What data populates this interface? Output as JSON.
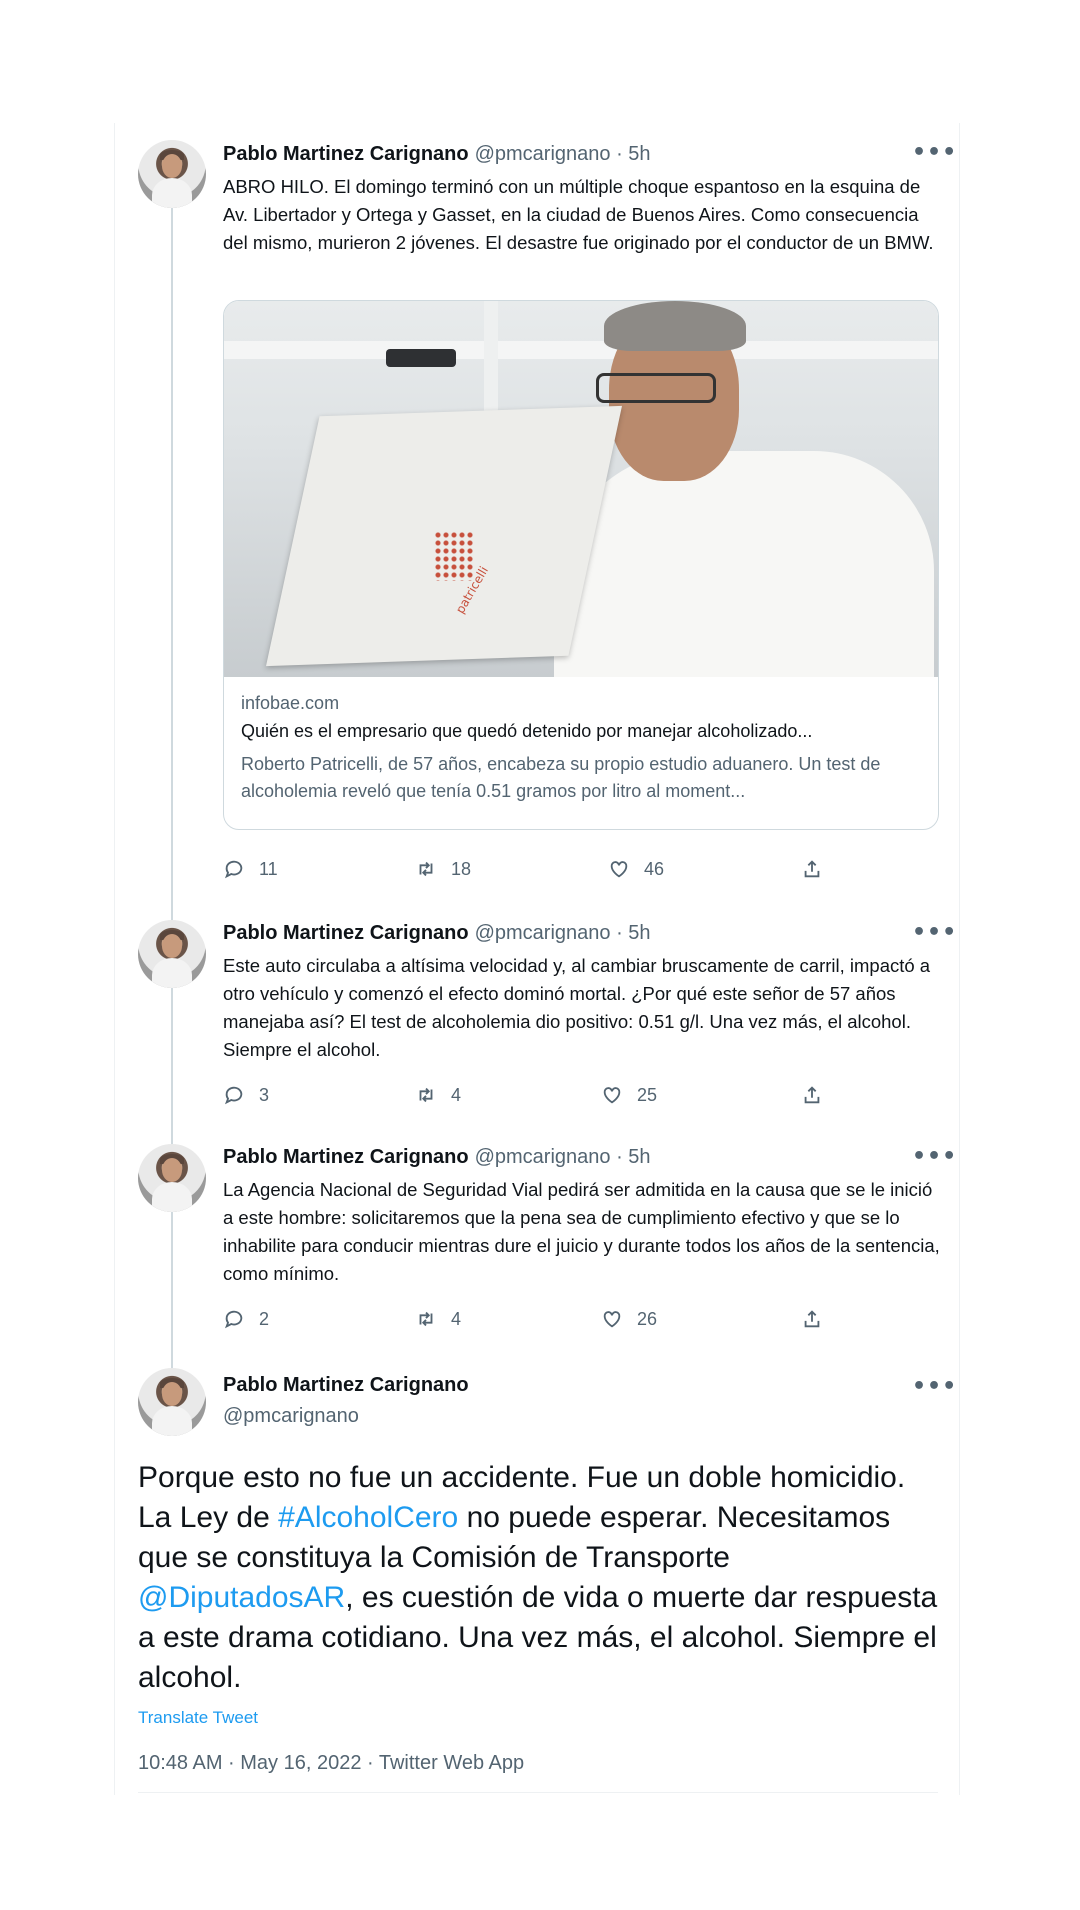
{
  "tweets": [
    {
      "author": "Pablo Martinez Carignano",
      "meta": "@pmcarignano · 5h",
      "text": "ABRO HILO. El domingo terminó con un múltiple choque espantoso en la esquina de Av. Libertador y Ortega y Gasset, en la ciudad de Buenos Aires. Como consecuencia del mismo, murieron 2 jóvenes. El desastre fue originado por el conductor de un BMW.",
      "card": {
        "domain": "infobae.com",
        "title": "Quién es el empresario que quedó detenido por manejar alcoholizado...",
        "description": "Roberto Patricelli, de 57 años, encabeza su propio estudio aduanero. Un test de alcoholemia reveló que tenía 0.51 gramos por litro al moment...",
        "image_text": "patricelli"
      },
      "replies": "11",
      "retweets": "18",
      "likes": "46"
    },
    {
      "author": "Pablo Martinez Carignano",
      "meta": "@pmcarignano · 5h",
      "text": "Este auto circulaba a altísima velocidad y, al cambiar bruscamente de carril, impactó a otro vehículo y comenzó el efecto dominó mortal. ¿Por qué este señor de 57 años manejaba así? El test de alcoholemia dio positivo: 0.51 g/l. Una vez más, el alcohol. Siempre el alcohol.",
      "replies": "3",
      "retweets": "4",
      "likes": "25"
    },
    {
      "author": "Pablo Martinez Carignano",
      "meta": "@pmcarignano · 5h",
      "text": "La Agencia Nacional de Seguridad Vial pedirá ser admitida en la causa que se le inició a este hombre: solicitaremos que la pena sea de cumplimiento efectivo y que se lo inhabilite para conducir mientras dure el juicio y durante todos los años de la sentencia, como mínimo.",
      "replies": "2",
      "retweets": "4",
      "likes": "26"
    }
  ],
  "main_tweet": {
    "author": "Pablo Martinez Carignano",
    "handle": "@pmcarignano",
    "text_1": "Porque esto no fue un accidente. Fue un doble homicidio. La Ley de ",
    "hashtag": "#AlcoholCero",
    "text_2": " no puede esperar. Necesitamos que se constituya la Comisión de Transporte ",
    "mention": "@DiputadosAR",
    "text_3": ", es cuestión de vida o muerte dar respuesta a este drama cotidiano. Una vez más, el alcohol. Siempre el alcohol.",
    "translate_label": "Translate Tweet",
    "timestamp": "10:48 AM · May 16, 2022 · Twitter Web App"
  },
  "more_label": "•••",
  "icons": {
    "reply": "reply-icon",
    "retweet": "retweet-icon",
    "like": "heart-icon",
    "share": "share-icon",
    "more": "more-icon"
  },
  "colors": {
    "link": "#1d9bf0",
    "secondary_text": "#536471",
    "thread_line": "#cfd9de"
  }
}
